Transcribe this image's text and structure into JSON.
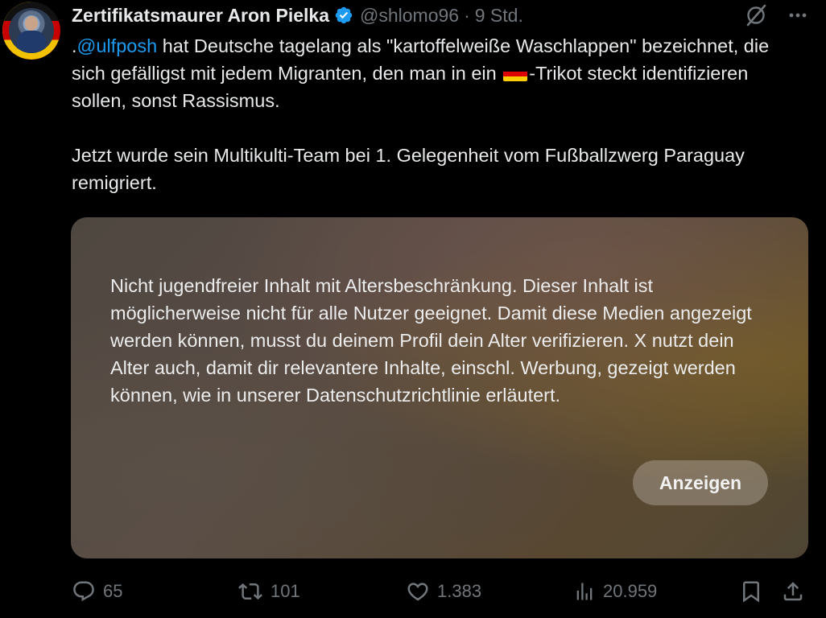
{
  "tweet": {
    "author": {
      "display_name": "Zertifikatsmaurer Aron Pielka",
      "handle": "@shlomo96",
      "verified": true
    },
    "separator": "·",
    "time": "9 Std.",
    "text": {
      "line1_prefix": ".",
      "mention": "@ulfposh",
      "line1_rest": " hat Deutsche tagelang als \"kartoffelweiße Waschlappen\" bezeichnet, die sich gefälligst mit jedem Migranten, den man in ein ",
      "flag_emoji": "flag-germany",
      "line1_end": "-Trikot steckt identifizieren sollen, sonst Rassismus.",
      "paragraph2": "Jetzt wurde sein Multikulti-Team bei 1. Gelegenheit vom Fußballzwerg Paraguay remigriert."
    },
    "media": {
      "warning_text": "Nicht jugendfreier Inhalt mit Altersbeschränkung. Dieser Inhalt ist möglicherweise nicht für alle Nutzer geeignet. Damit diese Medien angezeigt werden können, musst du deinem Profil dein Alter verifizieren. X nutzt dein Alter auch, damit dir relevantere Inhalte, einschl. Werbung, gezeigt werden können, wie in unserer Datenschutzrichtlinie erläutert.",
      "show_button_label": "Anzeigen"
    },
    "actions": {
      "replies": "65",
      "reposts": "101",
      "likes": "1.383",
      "views": "20.959"
    }
  },
  "colors": {
    "background": "#000000",
    "text_primary": "#e7e9ea",
    "text_secondary": "#71767b",
    "link": "#1d9bf0",
    "verified_badge": "#1d9bf0"
  },
  "icons": {
    "top_right": [
      "grok-icon",
      "more-icon"
    ],
    "actions": [
      "reply-icon",
      "repost-icon",
      "like-icon",
      "views-icon",
      "bookmark-icon",
      "share-icon"
    ]
  }
}
